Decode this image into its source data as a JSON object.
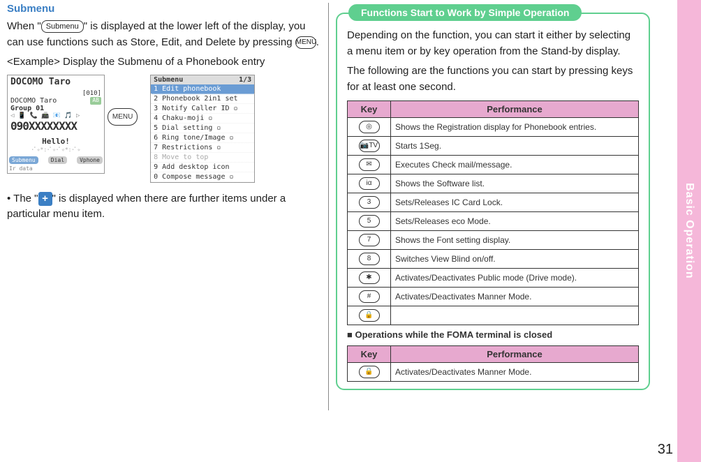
{
  "side_label": "Basic Operation",
  "page_number": "31",
  "left": {
    "heading": "Submenu",
    "para1a": "When \"",
    "submenu_btn": "Submenu",
    "para1b": "\" is displayed at the lower left of the display, you can use functions such as Store, Edit, and Delete by pressing ",
    "menu_key": "MENU",
    "para1c": ".",
    "example": "<Example> Display the Submenu of a Phonebook entry",
    "phone": {
      "title": "DOCOMO Taro",
      "count": "[010]",
      "name": "DOCOMO Taro",
      "reading": "AB",
      "group": "Group 01",
      "number": "090XXXXXXXX",
      "hello": "Hello!",
      "foot_submenu": "Submenu",
      "foot_dial": "Dial",
      "foot_vphone": "Vphone",
      "foot_irdata": "Ir data"
    },
    "menu_btn": "MENU",
    "submenu": {
      "title": "Submenu",
      "page": "1/3",
      "items": [
        {
          "n": "1",
          "label": "Edit phonebook",
          "sel": true
        },
        {
          "n": "2",
          "label": "Phonebook 2in1 set"
        },
        {
          "n": "3",
          "label": "Notify Caller ID",
          "ext": true
        },
        {
          "n": "4",
          "label": "Chaku-moji",
          "ext": true
        },
        {
          "n": "5",
          "label": "Dial setting",
          "ext": true
        },
        {
          "n": "6",
          "label": "Ring tone/Image",
          "ext": true
        },
        {
          "n": "7",
          "label": "Restrictions",
          "ext": true
        },
        {
          "n": "8",
          "label": "Move to top",
          "dis": true
        },
        {
          "n": "9",
          "label": "Add desktop icon"
        },
        {
          "n": "0",
          "label": "Compose message",
          "ext": true
        }
      ]
    },
    "note_a": "The \"",
    "plus": "+",
    "note_b": "\" is displayed when there are further items under a particular menu item."
  },
  "right": {
    "callout_title": "Functions Start to Work by Simple Operation",
    "intro1": "Depending on the function, you can start it either by selecting a menu item or by key operation from the Stand-by display.",
    "intro2": "The following are the functions you can start by pressing keys for at least one second.",
    "table": {
      "head_key": "Key",
      "head_perf": "Performance",
      "rows": [
        {
          "key": "◎",
          "perf": "Shows the Registration display for Phonebook entries."
        },
        {
          "key": "📷TV",
          "perf": "Starts 1Seg."
        },
        {
          "key": "✉",
          "perf": "Executes Check mail/message."
        },
        {
          "key": "iα",
          "perf": "Shows the Software list."
        },
        {
          "key": "3",
          "perf": "Sets/Releases IC Card Lock."
        },
        {
          "key": "5",
          "perf": "Sets/Releases eco Mode."
        },
        {
          "key": "7",
          "perf": "Shows the Font setting display."
        },
        {
          "key": "8",
          "perf": "Switches View Blind on/off."
        },
        {
          "key": "✱",
          "perf": "Activates/Deactivates Public mode (Drive mode)."
        },
        {
          "key": "#",
          "perf": "Activates/Deactivates Manner Mode."
        },
        {
          "key": "🔒",
          "perf": ""
        }
      ]
    },
    "closed_heading": "Operations while the FOMA terminal is closed",
    "table2": {
      "head_key": "Key",
      "head_perf": "Performance",
      "rows": [
        {
          "key": "🔒",
          "perf": "Activates/Deactivates Manner Mode."
        }
      ]
    }
  }
}
